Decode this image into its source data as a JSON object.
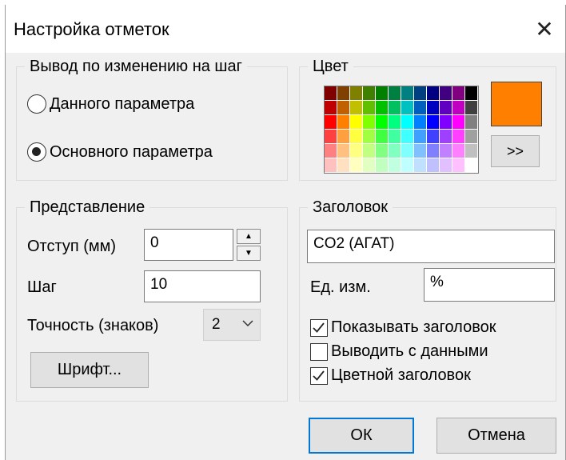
{
  "dialog": {
    "title": "Настройка отметок",
    "close_glyph": "✕"
  },
  "output_group": {
    "legend": "Вывод по изменению на шаг",
    "options": [
      {
        "label": "Данного параметра",
        "selected": false
      },
      {
        "label": "Основного параметра",
        "selected": true
      }
    ]
  },
  "color_group": {
    "legend": "Цвет",
    "selected_color": "#ff8000",
    "more_label": ">>",
    "palette": [
      [
        "#800000",
        "#804000",
        "#808000",
        "#408000",
        "#008000",
        "#008040",
        "#008080",
        "#004080",
        "#000080",
        "#400080",
        "#800080",
        "#000000"
      ],
      [
        "#c00000",
        "#c06000",
        "#c0c000",
        "#60c000",
        "#00c000",
        "#00c060",
        "#00c0c0",
        "#0060c0",
        "#0000c0",
        "#6000c0",
        "#c000c0",
        "#404040"
      ],
      [
        "#ff0000",
        "#ff8000",
        "#ffff00",
        "#80ff00",
        "#00ff00",
        "#00ff80",
        "#00ffff",
        "#0080ff",
        "#0000ff",
        "#8000ff",
        "#ff00ff",
        "#808080"
      ],
      [
        "#ff4040",
        "#ffa040",
        "#ffff40",
        "#a0ff40",
        "#40ff40",
        "#40ffa0",
        "#40ffff",
        "#40a0ff",
        "#4040ff",
        "#a040ff",
        "#ff40ff",
        "#a0a0a0"
      ],
      [
        "#ff8080",
        "#ffc080",
        "#ffff80",
        "#c0ff80",
        "#80ff80",
        "#80ffc0",
        "#80ffff",
        "#80c0ff",
        "#8080ff",
        "#c080ff",
        "#ff80ff",
        "#c0c0c0"
      ],
      [
        "#ffc0c0",
        "#ffe0c0",
        "#ffffc0",
        "#e0ffc0",
        "#c0ffc0",
        "#c0ffe0",
        "#c0ffff",
        "#c0e0ff",
        "#c0c0ff",
        "#e0c0ff",
        "#ffc0ff",
        "#ffffff"
      ]
    ]
  },
  "view_group": {
    "legend": "Представление",
    "indent_label": "Отступ (мм)",
    "indent_value": "0",
    "step_label": "Шаг",
    "step_value": "10",
    "precision_label": "Точность (знаков)",
    "precision_value": "2",
    "font_button": "Шрифт..."
  },
  "header_group": {
    "legend": "Заголовок",
    "title_value": "CO2 (АГАТ)",
    "unit_label": "Ед. изм.",
    "unit_value": "%",
    "checkboxes": [
      {
        "label": "Показывать заголовок",
        "checked": true
      },
      {
        "label": "Выводить с данными",
        "checked": false
      },
      {
        "label": "Цветной заголовок",
        "checked": true
      }
    ]
  },
  "buttons": {
    "ok": "ОК",
    "cancel": "Отмена"
  }
}
